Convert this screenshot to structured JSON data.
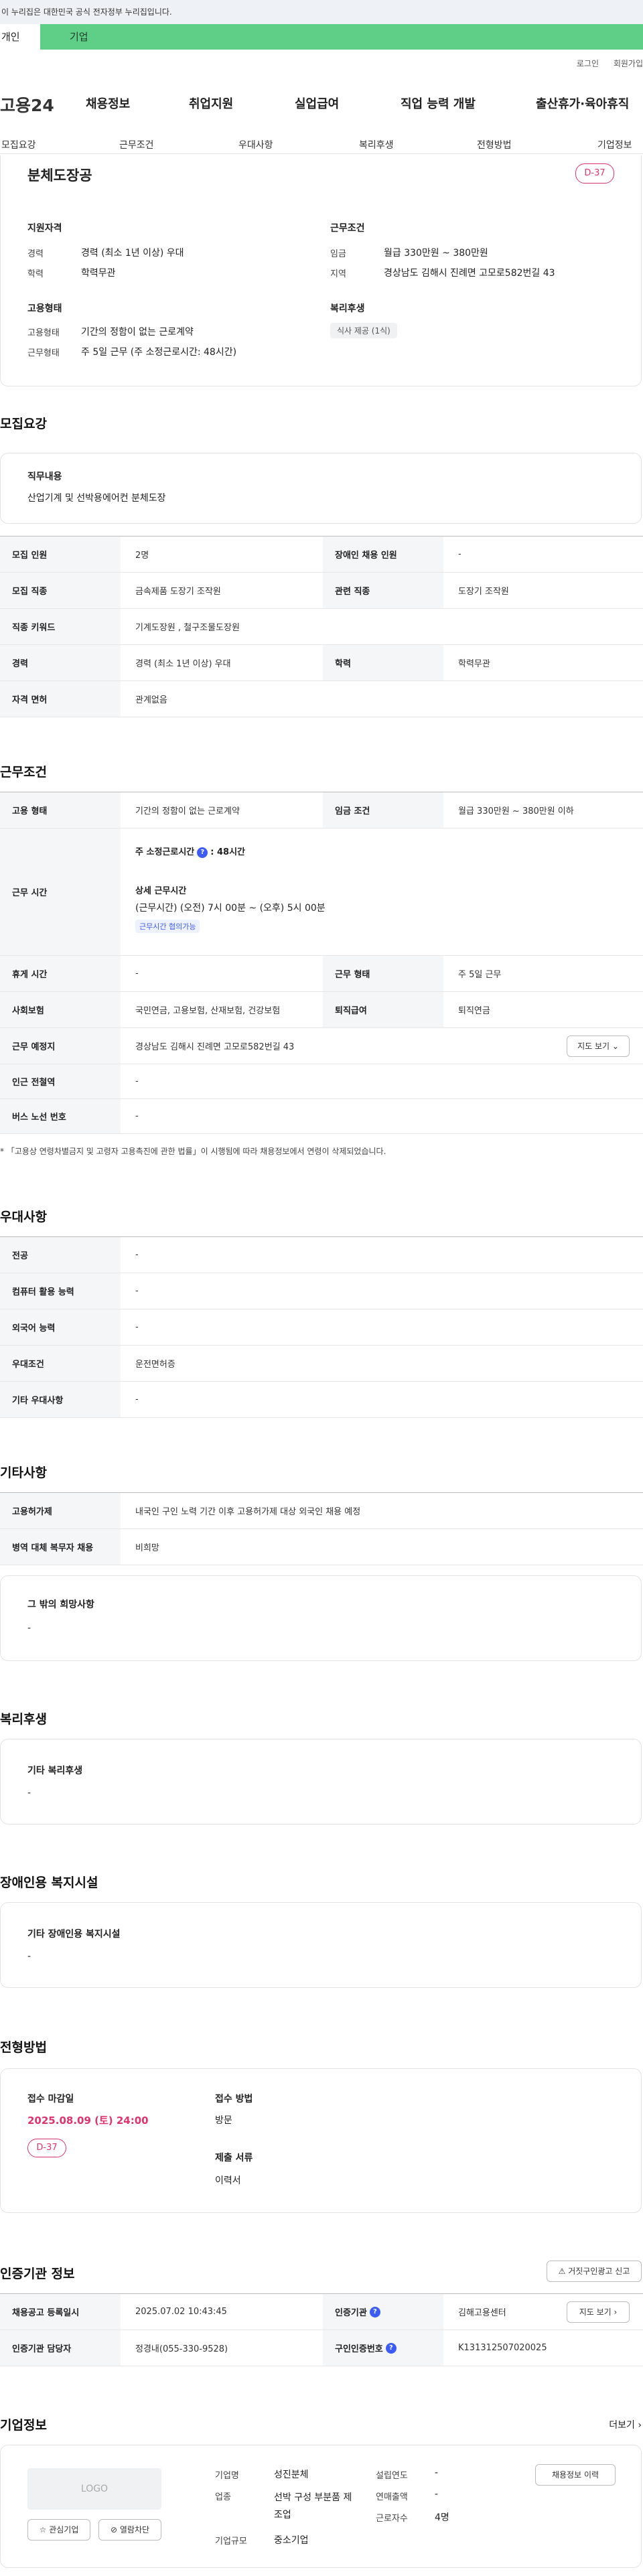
{
  "gov_banner": "이 누리집은 대한민국 공식 전자정부 누리집입니다.",
  "tabs": [
    "개인",
    "기업"
  ],
  "util_links": [
    "로그인",
    "회원가입"
  ],
  "logo": "고용24",
  "gnb": [
    "채용정보",
    "취업지원",
    "실업급여",
    "직업 능력 개발",
    "출산휴가·육아휴직"
  ],
  "subnav": [
    "모집요강",
    "근무조건",
    "우대사항",
    "복리후생",
    "전형방법",
    "기업정보"
  ],
  "summary": {
    "title": "분체도장공",
    "dday": "D-37",
    "qual_h": "지원자격",
    "career_l": "경력",
    "career_v": "경력 (최소 1년 이상) 우대",
    "edu_l": "학력",
    "edu_v": "학력무관",
    "emp_h": "고용형태",
    "emptype_l": "고용형태",
    "emptype_v": "기간의 정함이 없는 근로계약",
    "hours_l": "근무형태",
    "hours_v": "주 5일 근무 (주 소정근로시간: 48시간)",
    "cond_h": "근무조건",
    "wage_l": "임금",
    "wage_v": "월급 330만원 ~ 380만원",
    "region_l": "지역",
    "region_v": "경상남도 김해시 진례면 고모로582번길 43",
    "welfare_h": "복리후생",
    "welfare_chip": "식사 제공 (1식)"
  },
  "recruit": {
    "h": "모집요강",
    "job_h": "직무내용",
    "job_v": "산업기계 및 선박용에어컨 분체도장",
    "rows": [
      {
        "k1": "모집 인원",
        "v1": "2명",
        "k2": "장애인 채용 인원",
        "v2": "-"
      },
      {
        "k1": "모집 직종",
        "v1": "금속제품 도장기 조작원",
        "k2": "관련 직종",
        "v2": "도장기 조작원"
      },
      {
        "k1": "직종 키워드",
        "v1": "기계도장원 , 철구조물도장원",
        "k2": "",
        "v2": ""
      },
      {
        "k1": "경력",
        "v1": "경력 (최소 1년 이상) 우대",
        "k2": "학력",
        "v2": "학력무관"
      },
      {
        "k1": "자격 면허",
        "v1": "관계없음",
        "k2": "",
        "v2": ""
      }
    ]
  },
  "work": {
    "h": "근무조건",
    "type_k": "고용 형태",
    "type_v": "기간의 정함이 없는 근로계약",
    "wage_k": "임금 조건",
    "wage_v": "월급 330만원 ~ 380만원 이하",
    "time_k": "근무 시간",
    "time_weekly": "주 소정근로시간",
    "time_weekly_v": ": 48시간",
    "time_detail_h": "상세 근무시간",
    "time_detail_v": "(근무시간) (오전) 7시 00분 ~ (오후) 5시 00분",
    "time_badge": "근무시간 협의가능",
    "rest_k": "휴게 시간",
    "rest_v": "-",
    "shift_k": "근무 형태",
    "shift_v": "주 5일 근무",
    "ins_k": "사회보험",
    "ins_v": "국민연금, 고용보험, 산재보험, 건강보험",
    "sev_k": "퇴직급여",
    "sev_v": "퇴직연금",
    "loc_k": "근무 예정지",
    "loc_v": "경상남도 김해시 진례면 고모로582번길 43",
    "map_btn": "지도 보기",
    "subway_k": "인근 전철역",
    "subway_v": "-",
    "bus_k": "버스 노선 번호",
    "bus_v": "-",
    "note": "* 「고용상 연령차별금지 및 고령자 고용촉진에 관한 법률」이 시행됨에 따라 채용정보에서 연령이 삭제되었습니다."
  },
  "pref": {
    "h": "우대사항",
    "rows": [
      {
        "k": "전공",
        "v": "-"
      },
      {
        "k": "컴퓨터 활용 능력",
        "v": "-"
      },
      {
        "k": "외국어 능력",
        "v": "-"
      },
      {
        "k": "우대조건",
        "v": "운전면허증"
      },
      {
        "k": "기타 우대사항",
        "v": "-"
      }
    ]
  },
  "other": {
    "h": "기타사항",
    "rows": [
      {
        "k": "고용허가제",
        "v": "내국인 구인 노력 기간 이후 고용허가제 대상 외국인 채용 예정"
      },
      {
        "k": "병역 대체 복무자 채용",
        "v": "비희망"
      }
    ],
    "hope_h": "그 밖의 희망사항",
    "hope_v": "-"
  },
  "welfare": {
    "h": "복리후생",
    "box_h": "기타 복리후생",
    "box_v": "-"
  },
  "disabled": {
    "h": "장애인용 복지시설",
    "box_h": "기타 장애인용 복지시설",
    "box_v": "-"
  },
  "process": {
    "h": "전형방법",
    "deadline_h": "접수 마감일",
    "deadline_v": "2025.08.09 (토) 24:00",
    "dday": "D-37",
    "method_h": "접수 방법",
    "method_v": "방문",
    "docs_h": "제출 서류",
    "docs_v": "이력서"
  },
  "agency": {
    "h": "인증기관 정보",
    "report_btn": "거짓구인광고 신고",
    "reg_k": "채용공고 등록일시",
    "reg_v": "2025.07.02 10:43:45",
    "org_k": "인증기관",
    "org_v": "김해고용센터",
    "map_btn": "지도 보기",
    "mgr_k": "인증기관 담당자",
    "mgr_v": "정경내(055-330-9528)",
    "num_k": "구인인증번호",
    "num_v": "K131312507020025"
  },
  "company": {
    "h": "기업정보",
    "more": "더보기",
    "logo_text": "LOGO",
    "fav_btn": "관심기업",
    "block_btn": "열람차단",
    "name_k": "기업명",
    "name_v": "성진분체",
    "biz_k": "업종",
    "biz_v": "선박 구성 부분품 제조업",
    "size_k": "기업규모",
    "size_v": "중소기업",
    "year_k": "설립연도",
    "year_v": "-",
    "sales_k": "연매출액",
    "sales_v": "-",
    "emp_k": "근로자수",
    "emp_v": "4명",
    "history_btn": "채용정보 이력"
  },
  "colors": {
    "accent": "#5fcf87",
    "dday": "#e0336d",
    "blue": "#3d5cf5"
  }
}
